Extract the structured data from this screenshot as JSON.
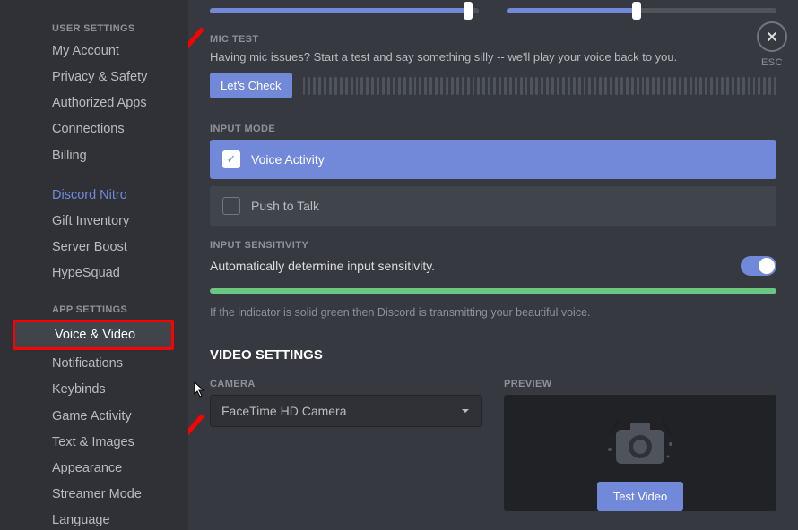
{
  "sidebar": {
    "user_header": "USER SETTINGS",
    "user_items": [
      "My Account",
      "Privacy & Safety",
      "Authorized Apps",
      "Connections",
      "Billing"
    ],
    "nitro_items": [
      "Discord Nitro",
      "Gift Inventory",
      "Server Boost",
      "HypeSquad"
    ],
    "app_header": "APP SETTINGS",
    "app_items": [
      "Voice & Video",
      "Notifications",
      "Keybinds",
      "Game Activity",
      "Text & Images",
      "Appearance",
      "Streamer Mode",
      "Language"
    ]
  },
  "close_label": "ESC",
  "sliders": {
    "a_pct": 96,
    "b_pct": 48
  },
  "mic_test": {
    "head": "MIC TEST",
    "desc": "Having mic issues? Start a test and say something silly -- we'll play your voice back to you.",
    "button": "Let's Check"
  },
  "input_mode": {
    "head": "INPUT MODE",
    "voice_activity": "Voice Activity",
    "push_to_talk": "Push to Talk"
  },
  "sensitivity": {
    "head": "INPUT SENSITIVITY",
    "auto_label": "Automatically determine input sensitivity.",
    "auto_enabled": true,
    "hint": "If the indicator is solid green then Discord is transmitting your beautiful voice."
  },
  "video": {
    "head": "VIDEO SETTINGS",
    "camera_head": "CAMERA",
    "camera_value": "FaceTime HD Camera",
    "preview_head": "PREVIEW",
    "test_button": "Test Video"
  }
}
